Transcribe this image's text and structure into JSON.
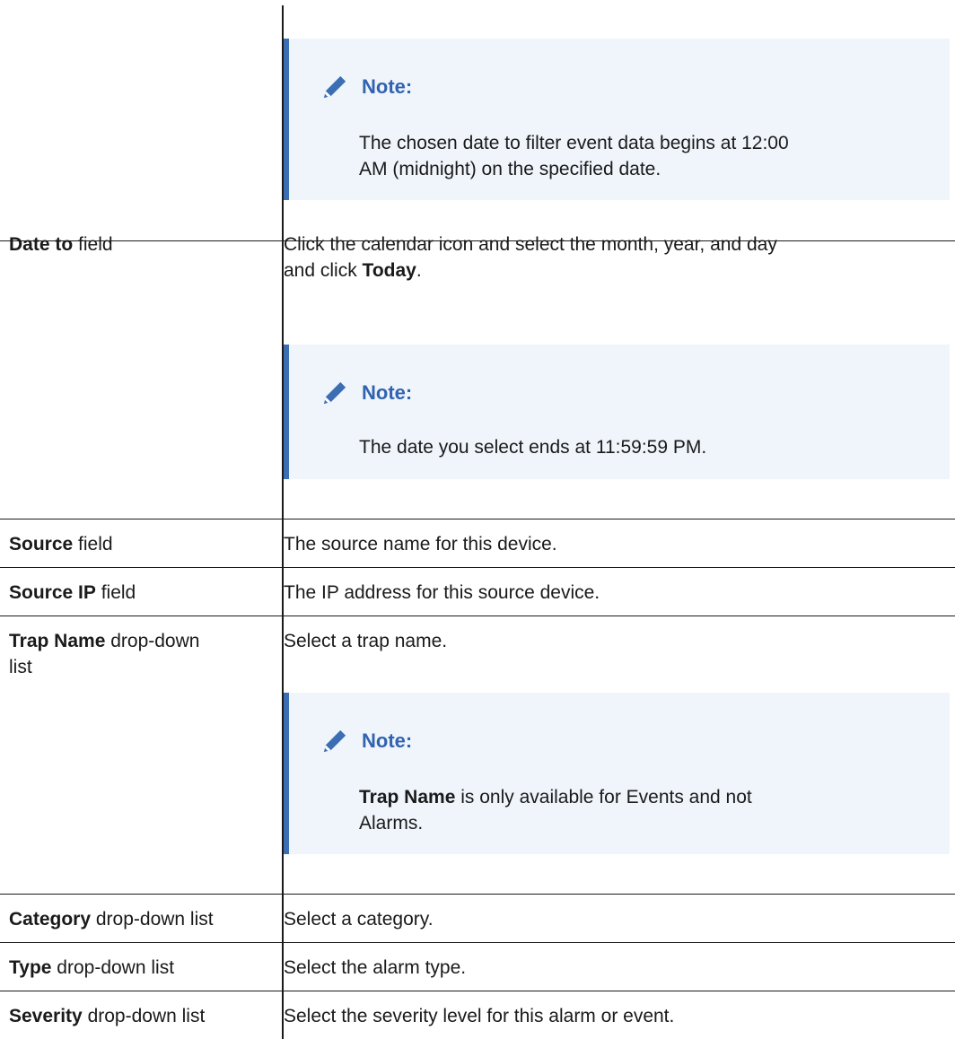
{
  "rows": {
    "date_from": {
      "note": {
        "title": "Note:",
        "line1": "The chosen date to filter event data begins at 12:00",
        "line2": "AM (midnight) on the specified date."
      }
    },
    "date_to": {
      "label_bold": "Date to",
      "label_rest": " field",
      "desc_line1": "Click the calendar icon and select the month, year, and day",
      "desc_pre": "and click ",
      "desc_bold": "Today",
      "desc_post": ".",
      "note": {
        "title": "Note:",
        "text": "The date you select ends at 11:59:59 PM."
      }
    },
    "source": {
      "label_bold": "Source",
      "label_rest": " field",
      "desc": "The source name for this device."
    },
    "source_ip": {
      "label_bold": "Source IP",
      "label_rest": " field",
      "desc": "The IP address for this source device."
    },
    "trap_name": {
      "label_bold": "Trap Name",
      "label_rest1": " drop-down",
      "label_rest2": "list",
      "desc": "Select a trap name.",
      "note": {
        "title": "Note:",
        "bold": "Trap Name",
        "rest1": " is only available for Events and not",
        "rest2": "Alarms."
      }
    },
    "category": {
      "label_bold": "Category",
      "label_rest": " drop-down list",
      "desc": "Select a category."
    },
    "type": {
      "label_bold": "Type",
      "label_rest": " drop-down list",
      "desc": "Select the alarm type."
    },
    "severity": {
      "label_bold": "Severity",
      "label_rest": " drop-down list",
      "desc": "Select the severity level for this alarm or event."
    }
  },
  "icons": {
    "note": "pencil-icon"
  },
  "colors": {
    "note_bg": "#f0f5fc",
    "note_border": "#3c6eb4",
    "note_title": "#3163b0"
  }
}
